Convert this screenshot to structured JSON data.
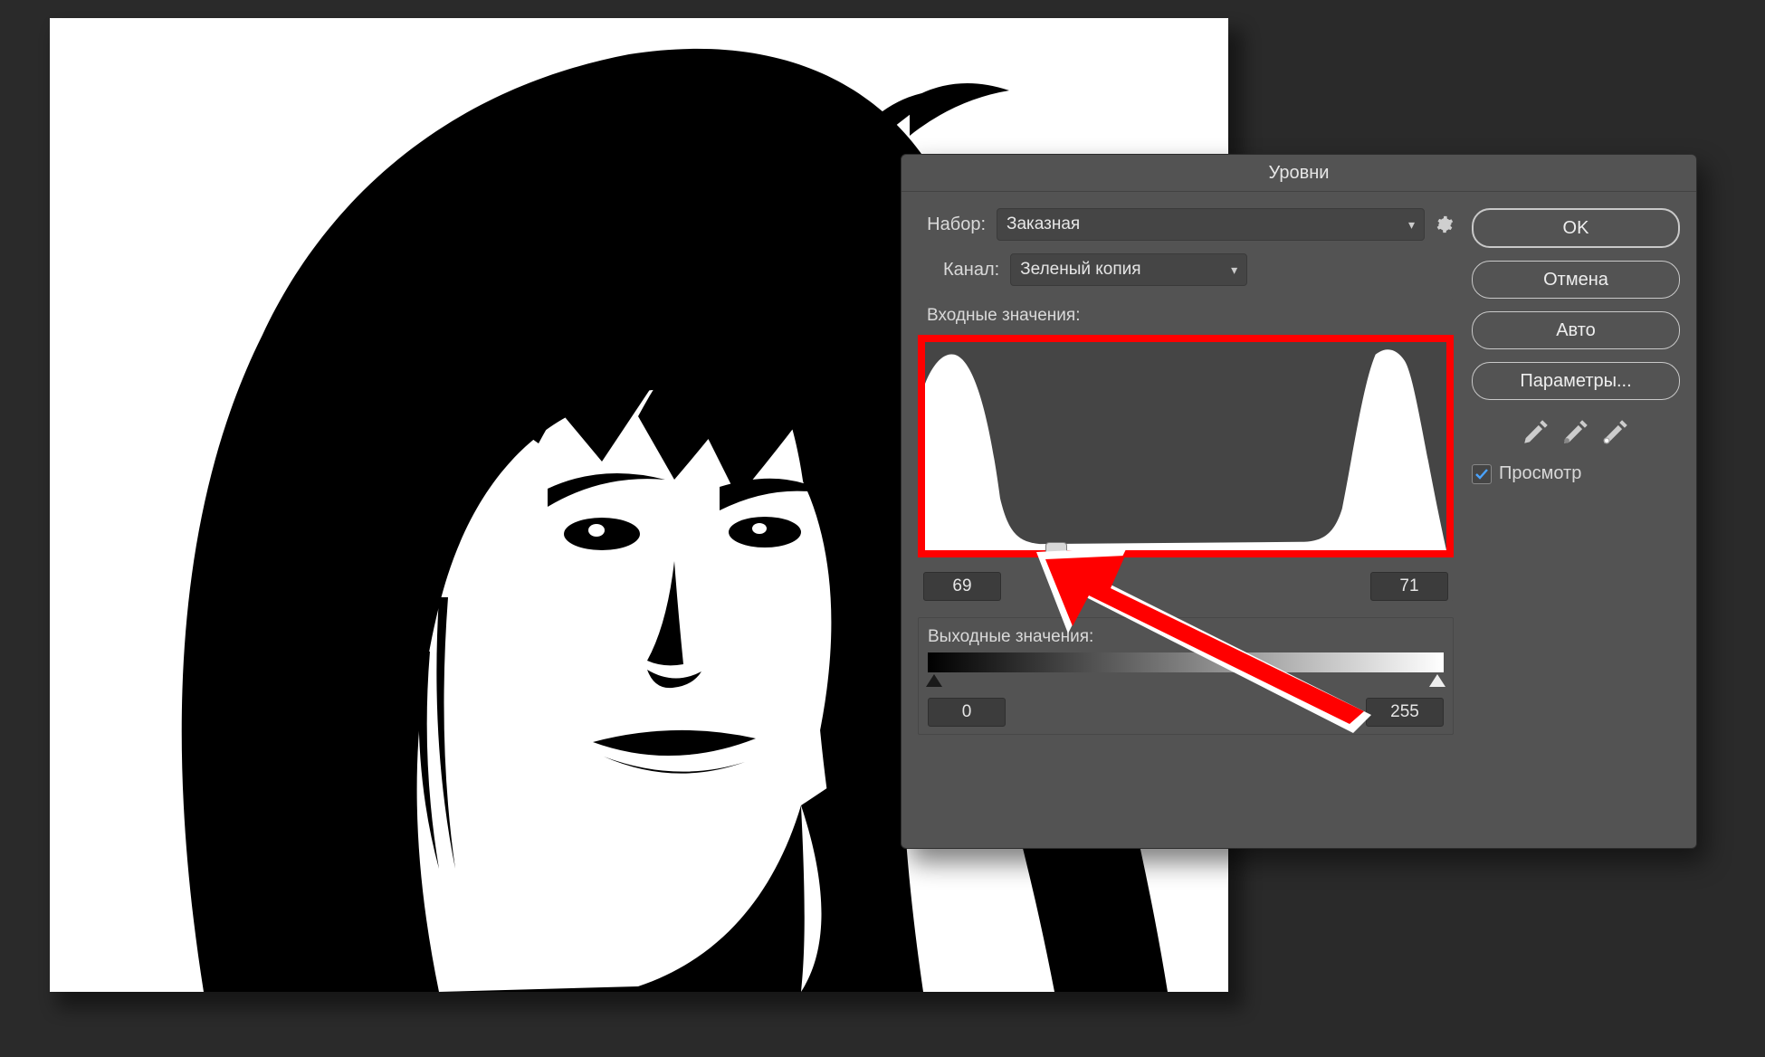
{
  "dialog": {
    "title": "Уровни",
    "preset_label": "Набор:",
    "preset_value": "Заказная",
    "channel_label": "Канал:",
    "channel_value": "Зеленый копия",
    "input_section": "Входные значения:",
    "output_section": "Выходные значения:",
    "input_black": "69",
    "input_white": "71",
    "output_black": "0",
    "output_white": "255"
  },
  "buttons": {
    "ok": "OK",
    "cancel": "Отмена",
    "auto": "Авто",
    "options": "Параметры..."
  },
  "preview": {
    "label": "Просмотр",
    "checked": true
  },
  "annotation": {
    "highlight_color": "#ff0000"
  }
}
